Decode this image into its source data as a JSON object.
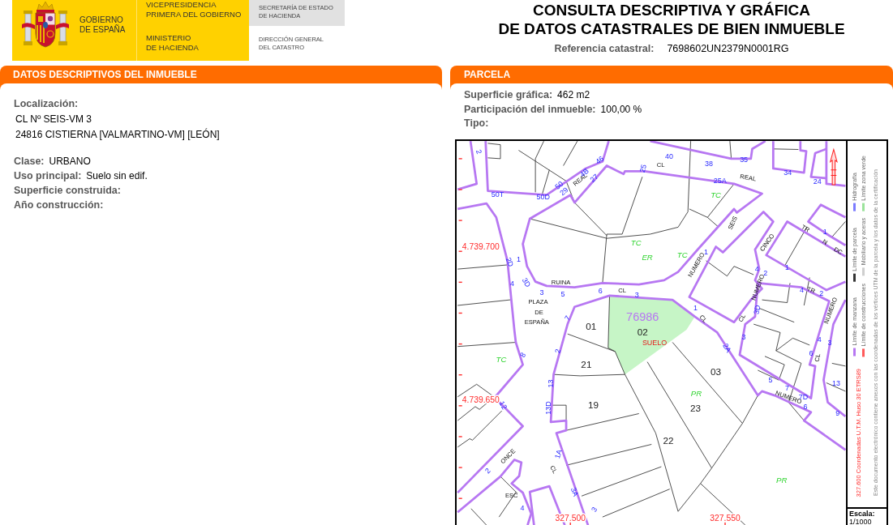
{
  "header": {
    "government": "GOBIERNO\nDE ESPAÑA",
    "vicepresidency": "VICEPRESIDENCIA\nPRIMERA DEL GOBIERNO",
    "ministry": "MINISTERIO\nDE HACIENDA",
    "secretariat": "SECRETARÍA DE ESTADO\nDE HACIENDA",
    "directorate": "DIRECCIÓN GENERAL\nDEL CATASTRO"
  },
  "title": "CONSULTA DESCRIPTIVA Y GRÁFICA\nDE DATOS CATASTRALES DE BIEN INMUEBLE",
  "reference": {
    "label": "Referencia catastral:",
    "value": "7698602UN2379N0001RG"
  },
  "property_panel": {
    "heading": "DATOS DESCRIPTIVOS DEL INMUEBLE",
    "location": {
      "label": "Localización:",
      "lines": [
        "CL Nº SEIS-VM 3",
        "24816 CISTIERNA [VALMARTINO-VM] [LEÓN]"
      ]
    },
    "fields": [
      {
        "label": "Clase:",
        "value": "URBANO"
      },
      {
        "label": "Uso principal:",
        "value": "Suelo sin edif."
      },
      {
        "label": "Superficie construida:"
      },
      {
        "label": "Año construcción:"
      }
    ]
  },
  "parcel_panel": {
    "heading": "PARCELA",
    "fields": [
      {
        "label": "Superficie gráfica:",
        "value": "462 m2"
      },
      {
        "label": "Participación del inmueble:",
        "value": "100,00 %"
      },
      {
        "label": "Tipo:"
      }
    ],
    "map": {
      "labels": [
        {
          "text": "2",
          "kind": "number"
        },
        {
          "text": "50T",
          "kind": "number"
        },
        {
          "text": "50D",
          "kind": "number"
        },
        {
          "text": "50",
          "kind": "number"
        },
        {
          "text": "29",
          "kind": "number"
        },
        {
          "text": "4B",
          "kind": "number"
        },
        {
          "text": "REAL",
          "kind": "street"
        },
        {
          "text": "27",
          "kind": "number"
        },
        {
          "text": "46",
          "kind": "number"
        },
        {
          "text": "25",
          "kind": "number"
        },
        {
          "text": "40",
          "kind": "number"
        },
        {
          "text": "CL",
          "kind": "street"
        },
        {
          "text": "38",
          "kind": "number"
        },
        {
          "text": "35",
          "kind": "number"
        },
        {
          "text": "25A",
          "kind": "number"
        },
        {
          "text": "REAL",
          "kind": "street"
        },
        {
          "text": "34",
          "kind": "number"
        },
        {
          "text": "24",
          "kind": "number"
        },
        {
          "text": "TC",
          "kind": "zone"
        },
        {
          "text": "SEIS",
          "kind": "street"
        },
        {
          "text": "CINCO",
          "kind": "street"
        },
        {
          "text": "TR",
          "kind": "street"
        },
        {
          "text": "1",
          "kind": "number"
        },
        {
          "text": "N",
          "kind": "street"
        },
        {
          "text": "DC",
          "kind": "street"
        },
        {
          "text": "1",
          "kind": "number"
        },
        {
          "text": "TC",
          "kind": "zone"
        },
        {
          "text": "ER",
          "kind": "zone"
        },
        {
          "text": "TC",
          "kind": "zone"
        },
        {
          "text": "1",
          "kind": "number"
        },
        {
          "text": "NUMERO",
          "kind": "street"
        },
        {
          "text": "4.739.700",
          "kind": "coordinate"
        },
        {
          "text": "1",
          "kind": "number"
        },
        {
          "text": "2D",
          "kind": "number"
        },
        {
          "text": "4",
          "kind": "number"
        },
        {
          "text": "3D",
          "kind": "number"
        },
        {
          "text": "RUINA",
          "kind": "street"
        },
        {
          "text": "3",
          "kind": "number"
        },
        {
          "text": "5",
          "kind": "number"
        },
        {
          "text": "6",
          "kind": "number"
        },
        {
          "text": "CL",
          "kind": "street"
        },
        {
          "text": "3",
          "kind": "number"
        },
        {
          "text": "PLAZA",
          "kind": "street"
        },
        {
          "text": "DE",
          "kind": "street"
        },
        {
          "text": "ESPAÑA",
          "kind": "street"
        },
        {
          "text": "7",
          "kind": "number"
        },
        {
          "text": "76986",
          "kind": "reference"
        },
        {
          "text": "01",
          "kind": "parcel"
        },
        {
          "text": "4",
          "kind": "number"
        },
        {
          "text": "2",
          "kind": "number"
        },
        {
          "text": "NUMERO",
          "kind": "street"
        },
        {
          "text": "4",
          "kind": "number"
        },
        {
          "text": "TR",
          "kind": "street"
        },
        {
          "text": "2",
          "kind": "number"
        },
        {
          "text": "NUMERO",
          "kind": "street"
        },
        {
          "text": "1",
          "kind": "number"
        },
        {
          "text": "CL",
          "kind": "street"
        },
        {
          "text": "CL",
          "kind": "street"
        },
        {
          "text": "3D",
          "kind": "number"
        },
        {
          "text": "02",
          "kind": "parcel"
        },
        {
          "text": "SUELO",
          "kind": "use"
        },
        {
          "text": "TC",
          "kind": "zone"
        },
        {
          "text": "8",
          "kind": "number"
        },
        {
          "text": "2",
          "kind": "number"
        },
        {
          "text": "21",
          "kind": "parcel"
        },
        {
          "text": "2A",
          "kind": "number"
        },
        {
          "text": "3",
          "kind": "number"
        },
        {
          "text": "4",
          "kind": "number"
        },
        {
          "text": "3",
          "kind": "number"
        },
        {
          "text": "6",
          "kind": "number"
        },
        {
          "text": "CL",
          "kind": "street"
        },
        {
          "text": "03",
          "kind": "parcel"
        },
        {
          "text": "13",
          "kind": "number"
        },
        {
          "text": "PR",
          "kind": "zone"
        },
        {
          "text": "5",
          "kind": "number"
        },
        {
          "text": "7",
          "kind": "number"
        },
        {
          "text": "NUMERO",
          "kind": "street"
        },
        {
          "text": "7D",
          "kind": "number"
        },
        {
          "text": "13",
          "kind": "number"
        },
        {
          "text": "6",
          "kind": "number"
        },
        {
          "text": "9",
          "kind": "number"
        },
        {
          "text": "4.739.650",
          "kind": "coordinate"
        },
        {
          "text": "12",
          "kind": "number"
        },
        {
          "text": "19",
          "kind": "parcel"
        },
        {
          "text": "13D",
          "kind": "number"
        },
        {
          "text": "23",
          "kind": "parcel"
        },
        {
          "text": "22",
          "kind": "parcel"
        },
        {
          "text": "1A",
          "kind": "number"
        },
        {
          "text": "CL",
          "kind": "street"
        },
        {
          "text": "ONCE",
          "kind": "street"
        },
        {
          "text": "2",
          "kind": "number"
        },
        {
          "text": "PR",
          "kind": "zone"
        },
        {
          "text": "ESC",
          "kind": "street"
        },
        {
          "text": "3A",
          "kind": "number"
        },
        {
          "text": "4",
          "kind": "number"
        },
        {
          "text": "327.500",
          "kind": "coordinate"
        },
        {
          "text": "327.550",
          "kind": "coordinate"
        },
        {
          "text": "3",
          "kind": "number"
        }
      ],
      "legend": [
        {
          "label": "Límite de manzana",
          "color": "#b777f2"
        },
        {
          "label": "Límite de parcela",
          "color": "#333333"
        },
        {
          "label": "Hidrografía",
          "color": "#7b7bff"
        },
        {
          "label": "Límite de construcciones",
          "color": "#ff5a5a"
        },
        {
          "label": "Mobiliario y aceras",
          "color": "#cfcfcf"
        },
        {
          "label": "Límite zona verde",
          "color": "#9be39b"
        }
      ],
      "coordinate_system": "327.600 Coordenadas U.T.M. Huso 30 ETRS89",
      "note": "Este documento electrónico contiene anexos con las coordenadas de los vértices UTM de la parcela y los datos de la certificación",
      "scale": {
        "label": "Escala:",
        "value": "1/1000"
      }
    }
  }
}
